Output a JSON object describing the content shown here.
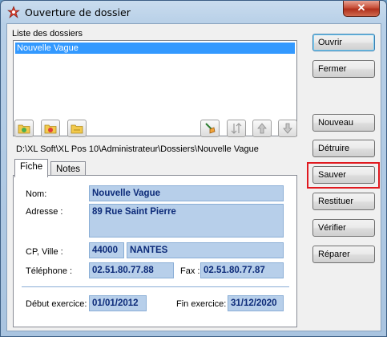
{
  "window": {
    "title": "Ouverture de dossier",
    "close_label": "✕"
  },
  "list": {
    "label": "Liste des dossiers",
    "items": [
      "Nouvelle Vague"
    ]
  },
  "path": "D:\\XL Soft\\XL Pos 10\\Administrateur\\Dossiers\\Nouvelle Vague",
  "tabs": [
    "Fiche",
    "Notes"
  ],
  "form": {
    "nom_label": "Nom:",
    "nom_value": "Nouvelle Vague",
    "adresse_label": "Adresse :",
    "adresse_value": "89 Rue Saint Pierre",
    "cp_label": "CP, Ville :",
    "cp_value": "44000",
    "ville_value": "NANTES",
    "tel_label": "Téléphone :",
    "tel_value": "02.51.80.77.88",
    "fax_label": "Fax :",
    "fax_value": "02.51.80.77.87",
    "debut_label": "Début exercice:",
    "debut_value": "01/01/2012",
    "fin_label": "Fin exercice:",
    "fin_value": "31/12/2020"
  },
  "buttons": {
    "ouvrir": "Ouvrir",
    "fermer": "Fermer",
    "nouveau": "Nouveau",
    "detruire": "Détruire",
    "sauver": "Sauver",
    "restituer": "Restituer",
    "verifier": "Vérifier",
    "reparer": "Réparer"
  },
  "colors": {
    "field_bg": "#b7cfea",
    "field_text": "#0c2a78",
    "selection": "#3399ff",
    "highlight": "#e0191f"
  },
  "toolbar_icons": [
    "folder-add-icon",
    "folder-remove-icon",
    "folder-open-icon",
    "broom-icon",
    "sort-icon",
    "arrow-up-icon",
    "arrow-down-icon"
  ]
}
